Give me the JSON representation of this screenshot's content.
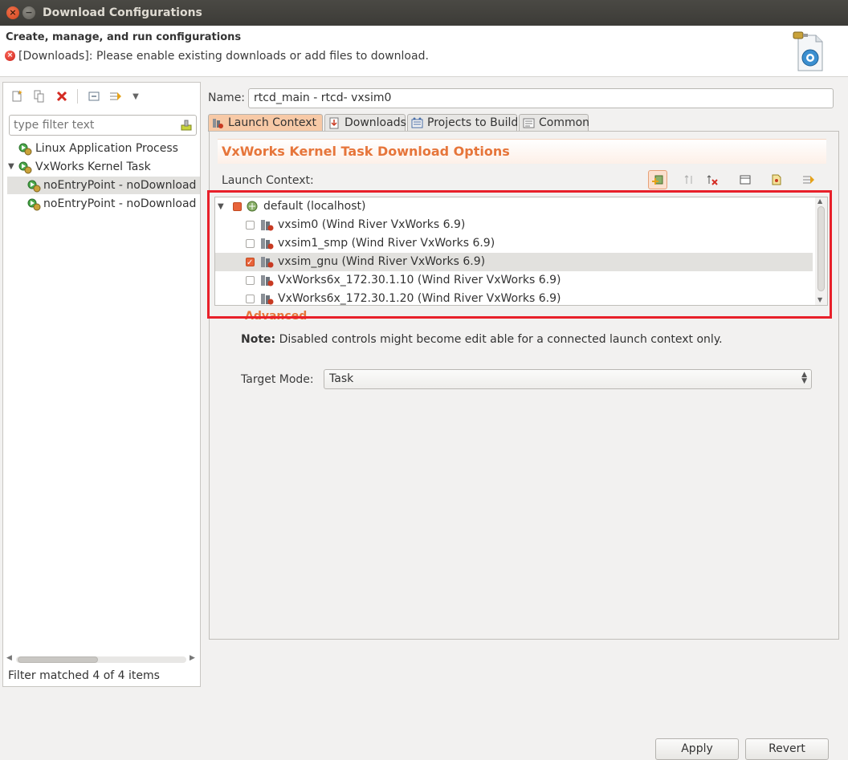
{
  "window": {
    "title": "Download Configurations"
  },
  "header": {
    "title": "Create, manage, and run configurations",
    "message": "[Downloads]: Please enable existing downloads or add files to download."
  },
  "sidebar": {
    "filter_placeholder": "type filter text",
    "tree": [
      {
        "label": "Linux Application Process",
        "level": 0,
        "expanded": false
      },
      {
        "label": "VxWorks Kernel Task",
        "level": 0,
        "expanded": true
      },
      {
        "label": "noEntryPoint - noDownload - ",
        "level": 1,
        "selected": true
      },
      {
        "label": "noEntryPoint - noDownload - ",
        "level": 1,
        "selected": false
      }
    ],
    "status": "Filter matched 4 of 4 items"
  },
  "main": {
    "name_label": "Name:",
    "name_value": "rtcd_main - rtcd- vxsim0",
    "tabs": [
      {
        "label": "Launch Context",
        "active": true
      },
      {
        "label": "Downloads",
        "active": false
      },
      {
        "label": "Projects to Build",
        "active": false
      },
      {
        "label": "Common",
        "active": false
      }
    ],
    "section_title": "VxWorks Kernel Task Download Options",
    "launch_context_label": "Launch Context:",
    "contexts": [
      {
        "label": "default (localhost)",
        "checked": false,
        "root": true
      },
      {
        "label": "vxsim0 (Wind River VxWorks 6.9)",
        "checked": false
      },
      {
        "label": "vxsim1_smp (Wind River VxWorks 6.9)",
        "checked": false
      },
      {
        "label": "vxsim_gnu (Wind River VxWorks 6.9)",
        "checked": true
      },
      {
        "label": "VxWorks6x_172.30.1.10 (Wind River VxWorks 6.9)",
        "checked": false
      },
      {
        "label": "VxWorks6x_172.30.1.20 (Wind River VxWorks 6.9)",
        "checked": false
      }
    ],
    "advanced_label": "Advanced",
    "note_bold": "Note:",
    "note_text": " Disabled controls might become edit able for a connected launch context only.",
    "target_mode_label": "Target Mode:",
    "target_mode_value": "Task"
  },
  "buttons": {
    "apply": "Apply",
    "revert": "Revert"
  },
  "colors": {
    "accent": "#e6753a",
    "highlight": "#e8202a",
    "selection": "#e2e1de",
    "titlebar": "#3c3b37"
  }
}
